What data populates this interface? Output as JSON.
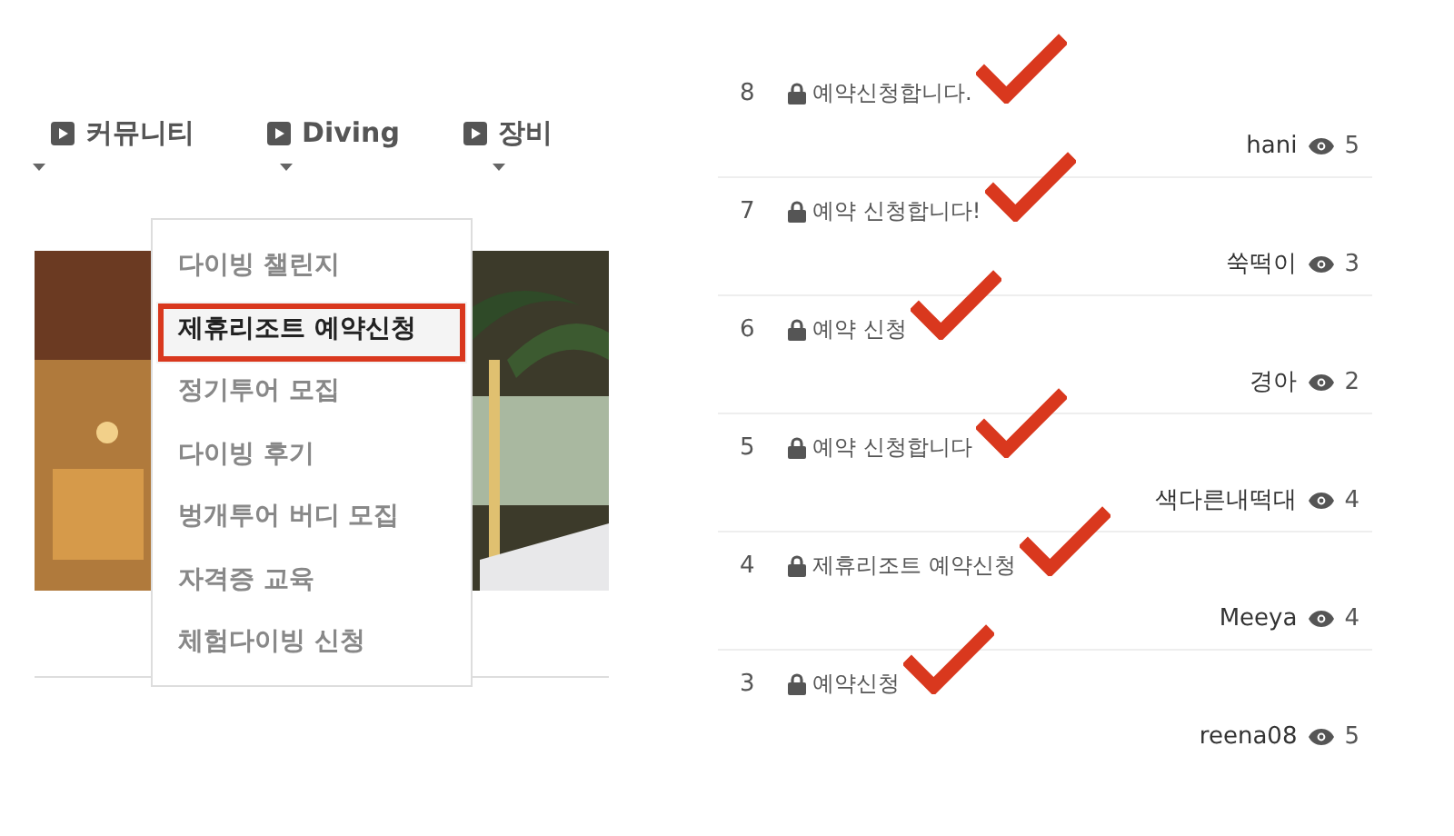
{
  "nav": [
    {
      "label": "커뮤니티"
    },
    {
      "label": "Diving"
    },
    {
      "label": "장비"
    }
  ],
  "dropdown": {
    "items": [
      {
        "label": "다이빙 챌린지",
        "selected": false
      },
      {
        "label": "제휴리조트 예약신청",
        "selected": true
      },
      {
        "label": "정기투어 모집",
        "selected": false
      },
      {
        "label": "다이빙 후기",
        "selected": false
      },
      {
        "label": "벙개투어 버디 모집",
        "selected": false
      },
      {
        "label": "자격증 교육",
        "selected": false
      },
      {
        "label": "체험다이빙 신청",
        "selected": false
      }
    ]
  },
  "posts": [
    {
      "number": "8",
      "title": "예약신청합니다.",
      "locked": true,
      "author": "hani",
      "views": "5",
      "checked": true
    },
    {
      "number": "7",
      "title": "예약 신청합니다!",
      "locked": true,
      "author": "쑥떡이",
      "views": "3",
      "checked": true
    },
    {
      "number": "6",
      "title": "예약 신청",
      "locked": true,
      "author": "경아",
      "views": "2",
      "checked": true
    },
    {
      "number": "5",
      "title": "예약 신청합니다",
      "locked": true,
      "author": "색다른내떡대",
      "views": "4",
      "checked": true
    },
    {
      "number": "4",
      "title": "제휴리조트 예약신청",
      "locked": true,
      "author": "Meeya",
      "views": "4",
      "checked": true
    },
    {
      "number": "3",
      "title": "예약신청",
      "locked": true,
      "author": "reena08",
      "views": "5",
      "checked": true
    }
  ]
}
